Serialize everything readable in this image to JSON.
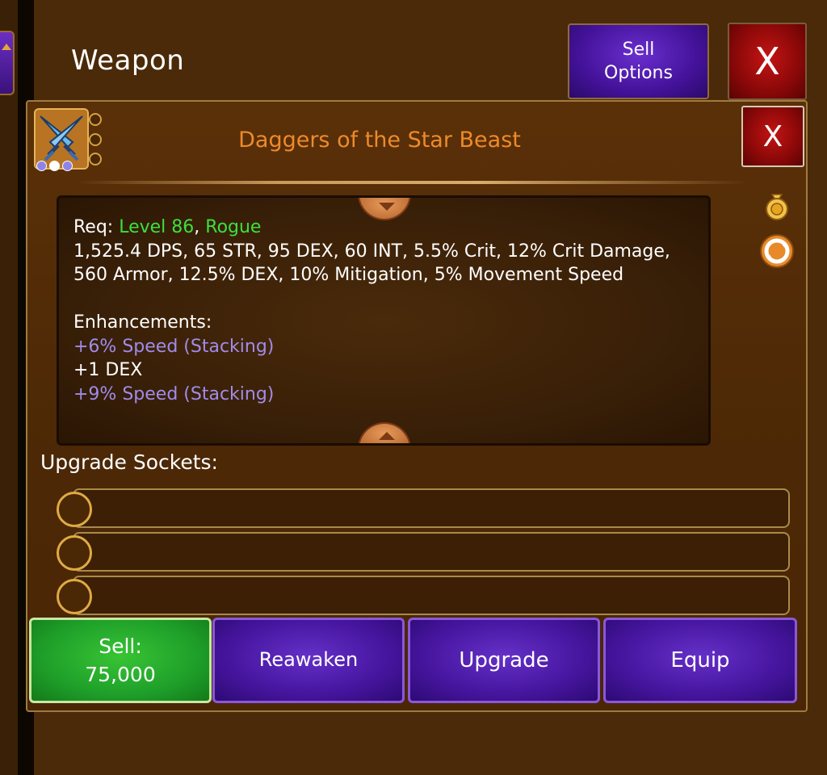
{
  "header": {
    "title": "Weapon",
    "sell_options_label": "Sell\nOptions",
    "close_label": "X"
  },
  "item": {
    "name": "Daggers of the Star Beast",
    "close_label": "X",
    "requirements": {
      "prefix": "Req: ",
      "level": "Level 86",
      "separator": ", ",
      "class": "Rogue"
    },
    "stats_line1": "1,525.4 DPS, 65 STR, 95 DEX, 60 INT, 5.5% Crit, 12% Crit Damage,",
    "stats_line2": "560 Armor, 12.5% DEX, 10% Mitigation, 5% Movement Speed",
    "enhancements_title": "Enhancements:",
    "enhancements": [
      {
        "text": "+6% Speed (Stacking)",
        "color": "#a08ce8"
      },
      {
        "text": "+1 DEX",
        "color": "#ffffff"
      },
      {
        "text": "+9% Speed (Stacking)",
        "color": "#a08ce8"
      }
    ]
  },
  "sockets": {
    "label": "Upgrade Sockets:"
  },
  "actions": {
    "sell_label": "Sell:\n75,000",
    "reawaken_label": "Reawaken",
    "upgrade_label": "Upgrade",
    "equip_label": "Equip"
  },
  "icons": {
    "item": "crossed-daggers-icon",
    "gold": "gold-pouch-icon",
    "swap": "swap-arrows-icon"
  },
  "colors": {
    "item_name": "#ee8a2a",
    "requirement": "#3ce03c",
    "enhancement_speed": "#a08ce8",
    "sell_button": "#1fa02a",
    "action_button": "#46159e",
    "close_button": "#8a0808"
  }
}
